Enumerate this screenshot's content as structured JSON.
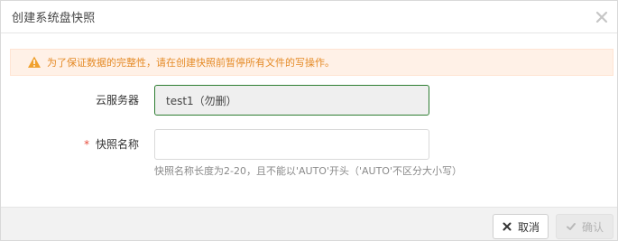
{
  "dialog": {
    "title": "创建系统盘快照",
    "close_icon": "close-icon"
  },
  "alert": {
    "icon": "warning-icon",
    "text": "为了保证数据的完整性，请在创建快照前暂停所有文件的写操作。",
    "color": "#e58b27",
    "background": "#fff1e7"
  },
  "form": {
    "server": {
      "label": "云服务器",
      "value": "test1（勿删）"
    },
    "snapshot_name": {
      "required_mark": "*",
      "label": "快照名称",
      "value": "",
      "placeholder": "",
      "hint": "快照名称长度为2-20，且不能以'AUTO'开头（'AUTO'不区分大小写）"
    }
  },
  "footer": {
    "cancel_label": "取消",
    "cancel_icon": "x-icon",
    "confirm_label": "确认",
    "confirm_icon": "check-icon",
    "confirm_disabled": true
  }
}
